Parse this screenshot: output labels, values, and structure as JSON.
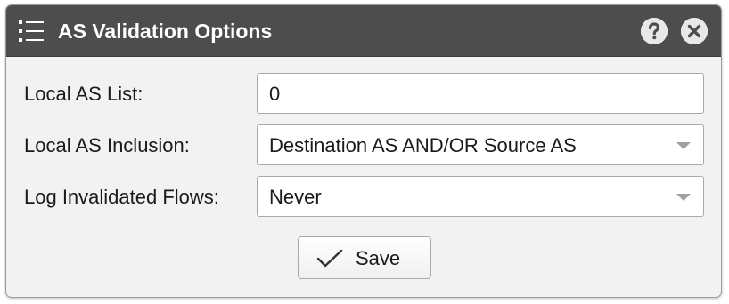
{
  "dialog": {
    "title": "AS Validation Options",
    "icons": {
      "menu": "list-menu-icon",
      "help": "question-mark-icon",
      "close": "close-icon"
    }
  },
  "form": {
    "local_as_list": {
      "label": "Local AS List:",
      "value": "0"
    },
    "local_as_inclusion": {
      "label": "Local AS Inclusion:",
      "selected": "Destination AS AND/OR Source AS"
    },
    "log_invalidated_flows": {
      "label": "Log Invalidated Flows:",
      "selected": "Never"
    }
  },
  "actions": {
    "save_label": "Save",
    "save_icon": "checkmark-icon"
  },
  "colors": {
    "titlebar": "#4d4d4d",
    "body": "#f2f2f2",
    "field": "#ffffff"
  }
}
